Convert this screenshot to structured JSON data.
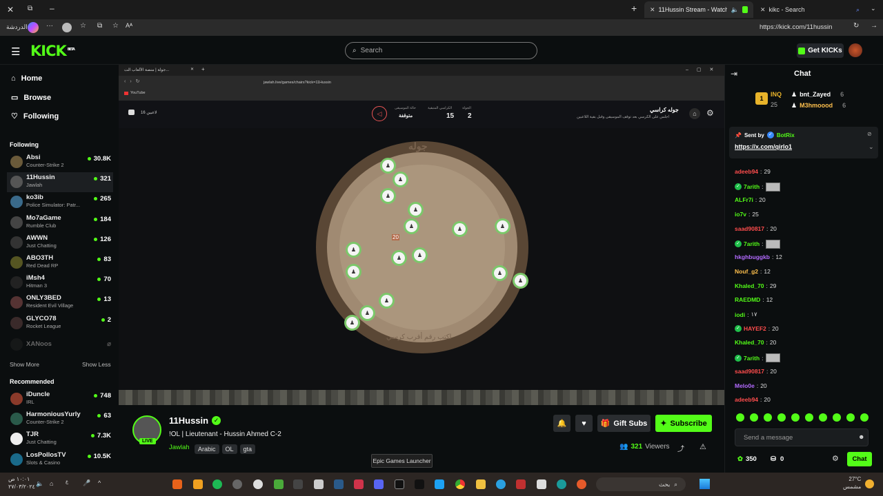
{
  "browser": {
    "tabs": [
      {
        "label": "11Hussin Stream - Watch Live"
      },
      {
        "label": "kikc - Search"
      }
    ],
    "profile_label": "الدردشة",
    "url": "https://kick.com/11hussin"
  },
  "header": {
    "logo": "KICK",
    "logo_badge": "BETA",
    "search_placeholder": "Search",
    "get_kicks": "Get KICKs"
  },
  "sidebar": {
    "nav": [
      {
        "label": "Home",
        "icon": "home-icon"
      },
      {
        "label": "Browse",
        "icon": "browse-icon"
      },
      {
        "label": "Following",
        "icon": "heart-icon"
      }
    ],
    "following_title": "Following",
    "following": [
      {
        "name": "Absi",
        "category": "Counter-Strike 2",
        "viewers": "30.8K",
        "color": "#6a5a3a"
      },
      {
        "name": "11Hussin",
        "category": "Jawlah",
        "viewers": "321",
        "color": "#555"
      },
      {
        "name": "ko3ib",
        "category": "Police Simulator: Patr...",
        "viewers": "265",
        "color": "#3a6a8a"
      },
      {
        "name": "Mo7aGame",
        "category": "Rumble Club",
        "viewers": "184",
        "color": "#444"
      },
      {
        "name": "AWWN",
        "category": "Just Chatting",
        "viewers": "126",
        "color": "#333"
      },
      {
        "name": "ABO3TH",
        "category": "Red Dead RP",
        "viewers": "83",
        "color": "#552"
      },
      {
        "name": "iMsh4",
        "category": "Hitman 3",
        "viewers": "70",
        "color": "#222"
      },
      {
        "name": "ONLY3BED",
        "category": "Resident Evil Village",
        "viewers": "13",
        "color": "#533"
      },
      {
        "name": "GLYCO78",
        "category": "Rocket League",
        "viewers": "2",
        "color": "#3a2a2a"
      }
    ],
    "offline": {
      "name": "XANoos"
    },
    "show_more": "Show More",
    "show_less": "Show Less",
    "recommended_title": "Recommended",
    "recommended": [
      {
        "name": "iDuncle",
        "category": "IRL",
        "viewers": "748",
        "color": "#8a3a2a"
      },
      {
        "name": "HarmoniousYurly",
        "category": "Counter-Strike 2",
        "viewers": "63",
        "color": "#2a5a4a"
      },
      {
        "name": "TJR",
        "category": "Just Chatting",
        "viewers": "7.3K",
        "color": "#eee"
      },
      {
        "name": "LosPollosTV",
        "category": "Slots & Casino",
        "viewers": "10.5K",
        "color": "#1a6a8a"
      }
    ]
  },
  "video": {
    "inner_tab": "جولة | منصة الألعاب الت...",
    "inner_url": "jawlah.live/games/chairs?kick=11Hussin",
    "bookmark": "YouTube",
    "game_title": "جوله كراسي",
    "game_subtitle": "اجلس على الكرسي بعد توقف الموسيقى وقبل بقية اللاعبين",
    "round_label": "الجولة",
    "round_value": "2",
    "chairs_label": "الكراسي المتبقية",
    "chairs_value": "15",
    "music_label": "حالة الموسيقى",
    "music_value": "متوقفة",
    "players_count": "16 لاعبين",
    "board_title": "جوله",
    "board_prompt": "اكتب رقم أقرب كرسي",
    "chair_number": "20"
  },
  "stream": {
    "username": "11Hussin",
    "live_label": "LIVE",
    "title": "!OL | Lieutenant - Hussin Ahmed C-2",
    "category": "Jawlah",
    "tags": [
      "Arabic",
      "OL",
      "gta"
    ],
    "viewers": "321",
    "viewers_label": "Viewers",
    "gift_subs": "Gift Subs",
    "subscribe": "Subscribe"
  },
  "chat": {
    "title": "Chat",
    "leaderboard": [
      {
        "user": "bnt_Zayed",
        "count": "6"
      },
      {
        "user": "M3hmoood",
        "count": "6"
      }
    ],
    "leader_top": {
      "name": "INQ",
      "count": "25"
    },
    "pinned_by_label": "Sent by",
    "pinned_by_user": "BotRix",
    "pinned_link": "https://x.com/qirlo1",
    "messages": [
      {
        "user": "adeeb94",
        "text": "29",
        "color": "#ff4d4d",
        "badge": false,
        "emote": false
      },
      {
        "user": "7arith",
        "text": "",
        "color": "#53fc18",
        "badge": true,
        "emote": true
      },
      {
        "user": "ALFr7i",
        "text": "20",
        "color": "#53fc18",
        "badge": false,
        "emote": false
      },
      {
        "user": "io7v",
        "text": "25",
        "color": "#53fc18",
        "badge": false,
        "emote": false
      },
      {
        "user": "saad90817",
        "text": "20",
        "color": "#ff4d4d",
        "badge": false,
        "emote": false
      },
      {
        "user": "7arith",
        "text": "",
        "color": "#53fc18",
        "badge": true,
        "emote": true
      },
      {
        "user": "hkghbuggkb",
        "text": "12",
        "color": "#b36bff",
        "badge": false,
        "emote": false
      },
      {
        "user": "Nouf_g2",
        "text": "12",
        "color": "#ffc04d",
        "badge": false,
        "emote": false
      },
      {
        "user": "Khaled_70",
        "text": "29",
        "color": "#53fc18",
        "badge": false,
        "emote": false
      },
      {
        "user": "RAEDMD",
        "text": "12",
        "color": "#53fc18",
        "badge": false,
        "emote": false
      },
      {
        "user": "iodi",
        "text": "١٧",
        "color": "#53fc18",
        "badge": false,
        "emote": false
      },
      {
        "user": "HAYEF2",
        "text": "20",
        "color": "#ff4d4d",
        "badge": true,
        "emote": false
      },
      {
        "user": "Khaled_70",
        "text": "20",
        "color": "#53fc18",
        "badge": false,
        "emote": false
      },
      {
        "user": "7arith",
        "text": "",
        "color": "#53fc18",
        "badge": true,
        "emote": true
      },
      {
        "user": "saad90817",
        "text": "20",
        "color": "#ff4d4d",
        "badge": false,
        "emote": false
      },
      {
        "user": "Melo0e",
        "text": "20",
        "color": "#b36bff",
        "badge": false,
        "emote": false
      },
      {
        "user": "adeeb94",
        "text": "20",
        "color": "#ff4d4d",
        "badge": false,
        "emote": false
      }
    ],
    "input_placeholder": "Send a message",
    "points": "350",
    "gifts": "0",
    "send_label": "Chat"
  },
  "taskbar": {
    "tooltip": "Epic Games Launcher",
    "search_label": "بحث",
    "temperature": "27°C",
    "weather": "مشمس",
    "time": "١٠:٠١ ص",
    "date": "٢٧/٠٣/٢٠٢٤"
  }
}
